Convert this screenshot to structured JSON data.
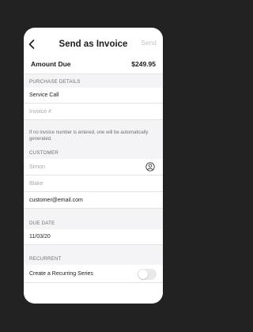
{
  "nav": {
    "title": "Send as Invoice",
    "send_label": "Send",
    "back_icon": "chevron-left-icon"
  },
  "amount": {
    "label": "Amount Due",
    "value": "$249.95"
  },
  "purchase": {
    "section_label": "PURCHASE DETAILS",
    "description": "Service Call",
    "invoice_placeholder": "Invoice #",
    "helper": "If no invoice number is entered, one will be automatically generated."
  },
  "customer": {
    "section_label": "CUSTOMER",
    "first_name_placeholder": "Simon",
    "last_name_placeholder": "Blake",
    "email": "customer@email.com",
    "contact_icon": "person-circle-icon"
  },
  "due_date": {
    "section_label": "DUE DATE",
    "value": "11/03/20"
  },
  "recurrent": {
    "section_label": "RECURRENT",
    "toggle_label": "Create a Recurring Series",
    "toggle_on": false
  },
  "colors": {
    "background": "#222222",
    "card": "#ffffff",
    "section_gap": "#f4f4f6",
    "disabled_text": "#c4c4c4"
  }
}
